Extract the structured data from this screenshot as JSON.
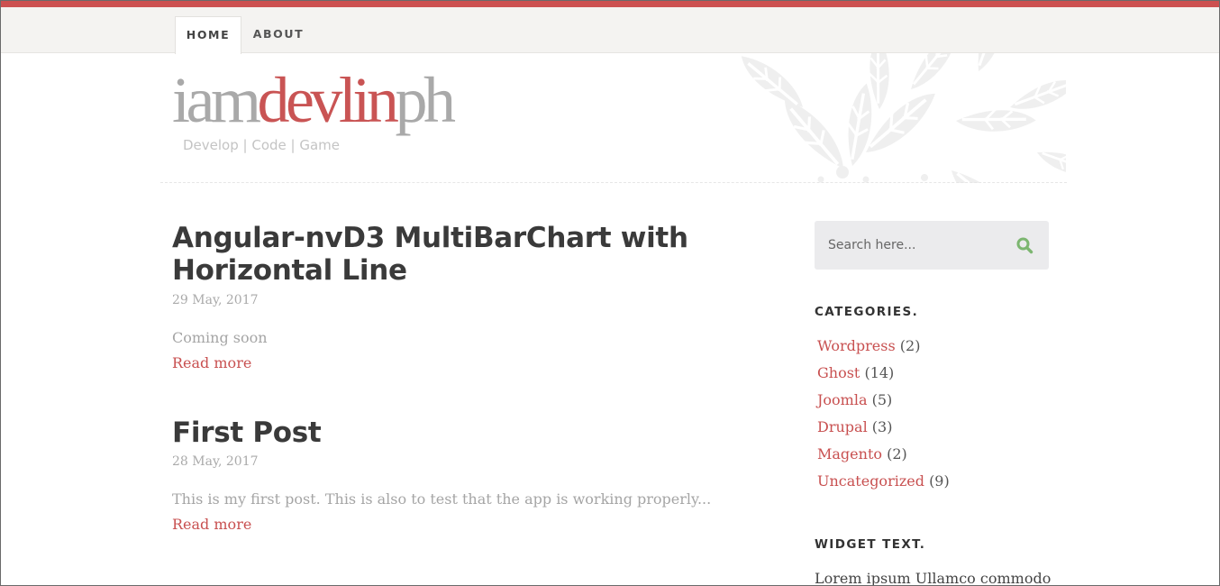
{
  "nav": {
    "tabs": [
      {
        "label": "HOME"
      },
      {
        "label": "ABOUT"
      }
    ]
  },
  "brand": {
    "logo_part1": "iam",
    "logo_part2": "devlin",
    "logo_part3": "ph",
    "tagline": "Develop | Code | Game"
  },
  "posts": [
    {
      "title": "Angular-nvD3 MultiBarChart with Horizontal Line",
      "date": "29 May, 2017",
      "excerpt": "Coming soon",
      "read_more": "Read more"
    },
    {
      "title": "First Post",
      "date": "28 May, 2017",
      "excerpt": "This is my first post. This is also to test that the app is working properly...",
      "read_more": "Read more"
    }
  ],
  "sidebar": {
    "search": {
      "placeholder": "Search here..."
    },
    "categories_title": "CATEGORIES.",
    "categories": [
      {
        "name": "Wordpress",
        "count": "(2)"
      },
      {
        "name": "Ghost",
        "count": "(14)"
      },
      {
        "name": "Joomla",
        "count": "(5)"
      },
      {
        "name": "Drupal",
        "count": "(3)"
      },
      {
        "name": "Magento",
        "count": "(2)"
      },
      {
        "name": "Uncategorized",
        "count": "(9)"
      }
    ],
    "widget_text_title": "WIDGET TEXT.",
    "widget_text_body": "Lorem ipsum Ullamco commodo"
  },
  "colors": {
    "accent": "#cc5050",
    "link": "#c85050",
    "search_icon": "#7cb670"
  }
}
